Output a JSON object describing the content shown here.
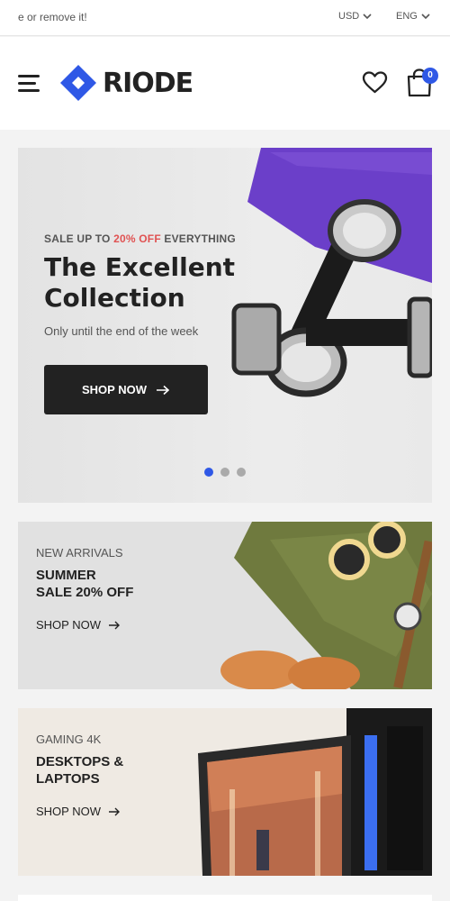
{
  "topbar": {
    "notice": "e or remove it!",
    "currency": "USD",
    "language": "ENG"
  },
  "header": {
    "logo_text": "RIODE",
    "cart_count": "0"
  },
  "hero": {
    "kicker_prefix": "SALE UP TO ",
    "kicker_highlight": "20% OFF",
    "kicker_suffix": " EVERYTHING",
    "title": "The Excellent Collection",
    "subtitle": "Only until the end of the week",
    "button_label": "SHOP NOW",
    "slide_count": 3,
    "active_slide": 1
  },
  "promos": [
    {
      "kicker": "NEW ARRIVALS",
      "title_line1": "SUMMER",
      "title_line2": "SALE 20% OFF",
      "link": "SHOP NOW"
    },
    {
      "kicker": "GAMING 4K",
      "title_line1": "DESKTOPS &",
      "title_line2": "LAPTOPS",
      "link": "SHOP NOW"
    }
  ],
  "colors": {
    "accent": "#2f58e6",
    "sale_highlight": "#e05252",
    "dark": "#222222"
  },
  "icons": {
    "menu": "hamburger-icon",
    "wishlist": "heart-icon",
    "cart": "shopping-bag-icon",
    "dropdown": "chevron-down-icon",
    "arrow": "arrow-right-icon"
  }
}
